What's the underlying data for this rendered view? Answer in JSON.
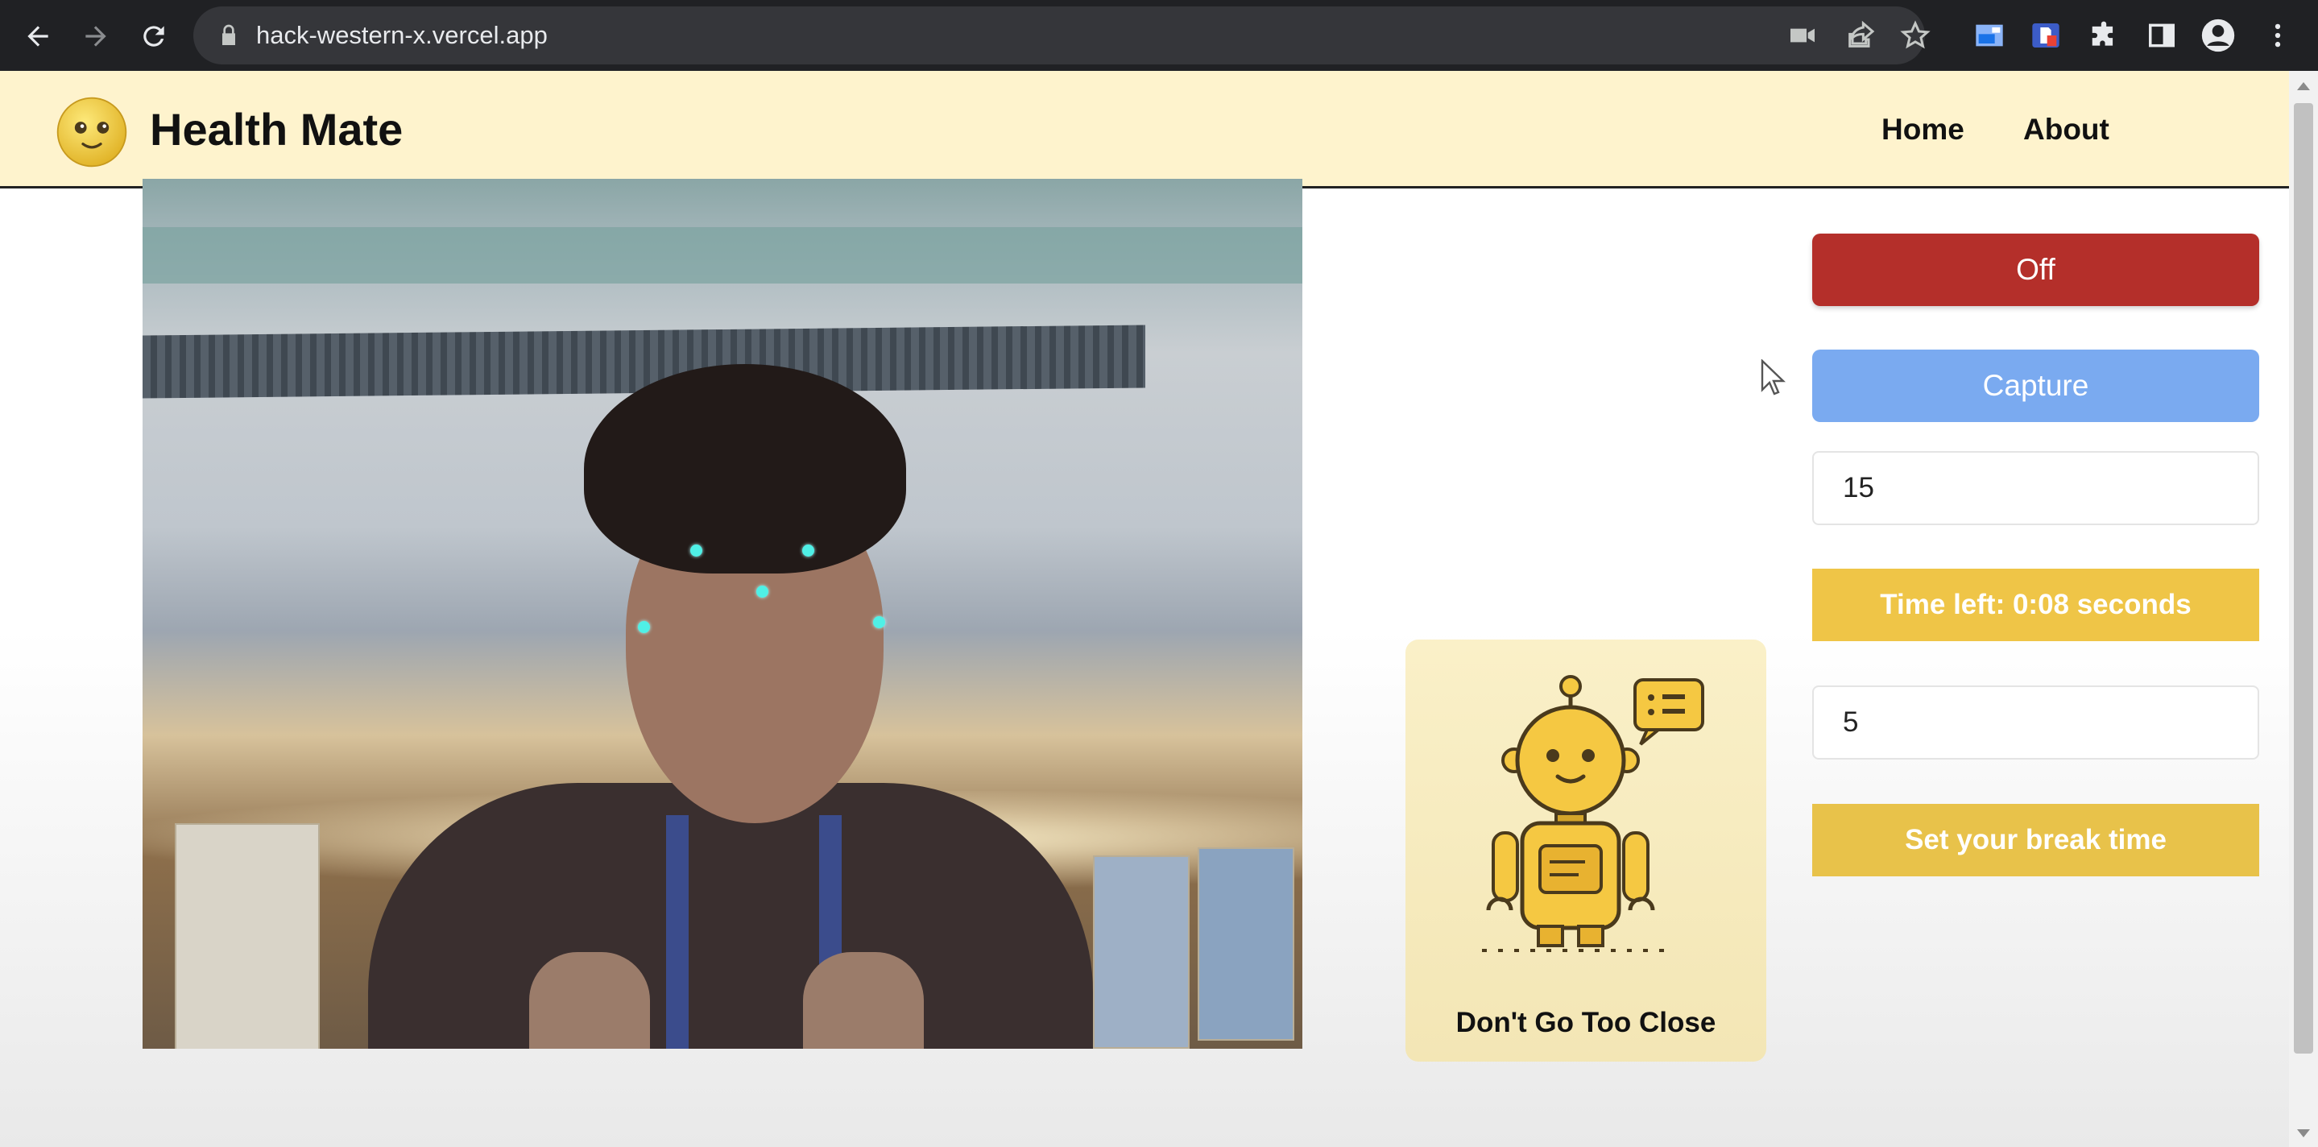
{
  "browser": {
    "url": "hack-western-x.vercel.app",
    "icons": [
      "back-icon",
      "forward-icon",
      "reload-icon",
      "lock-icon",
      "camera-icon",
      "share-icon",
      "star-icon",
      "extension-icon-1",
      "extension-icon-2",
      "puzzle-icon",
      "side-panel-icon",
      "profile-icon",
      "menu-icon"
    ]
  },
  "header": {
    "brand": "Health Mate",
    "nav": [
      "Home",
      "About"
    ]
  },
  "controls": {
    "toggle_label": "Off",
    "capture_label": "Capture",
    "interval_value": "15",
    "timer_text": "Time left: 0:08 seconds",
    "break_value": "5",
    "set_break_label": "Set your break time"
  },
  "robot_card": {
    "caption": "Don't Go Too Close"
  },
  "colors": {
    "header_bg": "#fef3cd",
    "off_button": "#b42f2a",
    "capture_button": "#7aaaf0",
    "timer_bg": "#efc547",
    "landmark": "#4ff0e6"
  }
}
